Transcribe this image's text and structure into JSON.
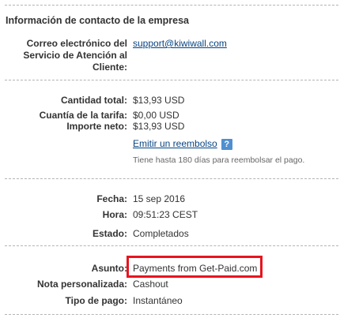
{
  "contact": {
    "title": "Información de contacto de la empresa",
    "label_line1": "Correo electrónico del",
    "label_line2": "Servicio de Atención al",
    "label_line3": "Cliente:",
    "email": "support@kiwiwall.com"
  },
  "amounts": {
    "total_label": "Cantidad total:",
    "total_value": "$13,93 USD",
    "fee_label": "Cuantía de la tarifa:",
    "fee_value": "$0,00 USD",
    "net_label": "Importe neto:",
    "net_value": "$13,93 USD",
    "refund_link": "Emitir un reembolso",
    "help_icon": "?",
    "refund_note": "Tiene hasta 180 días para reembolsar el pago."
  },
  "details": {
    "date_label": "Fecha:",
    "date_value": "15 sep 2016",
    "time_label": "Hora:",
    "time_value": "09:51:23 CEST",
    "status_label": "Estado:",
    "status_value": "Completados"
  },
  "payment": {
    "subject_label": "Asunto:",
    "subject_value": "Payments from Get-Paid.com",
    "note_label": "Nota personalizada:",
    "note_value": "Cashout",
    "type_label": "Tipo de pago:",
    "type_value": "Instantáneo"
  },
  "colors": {
    "link": "#084482",
    "highlight": "#e8141e",
    "help_icon_bg": "#4f8fd1"
  }
}
